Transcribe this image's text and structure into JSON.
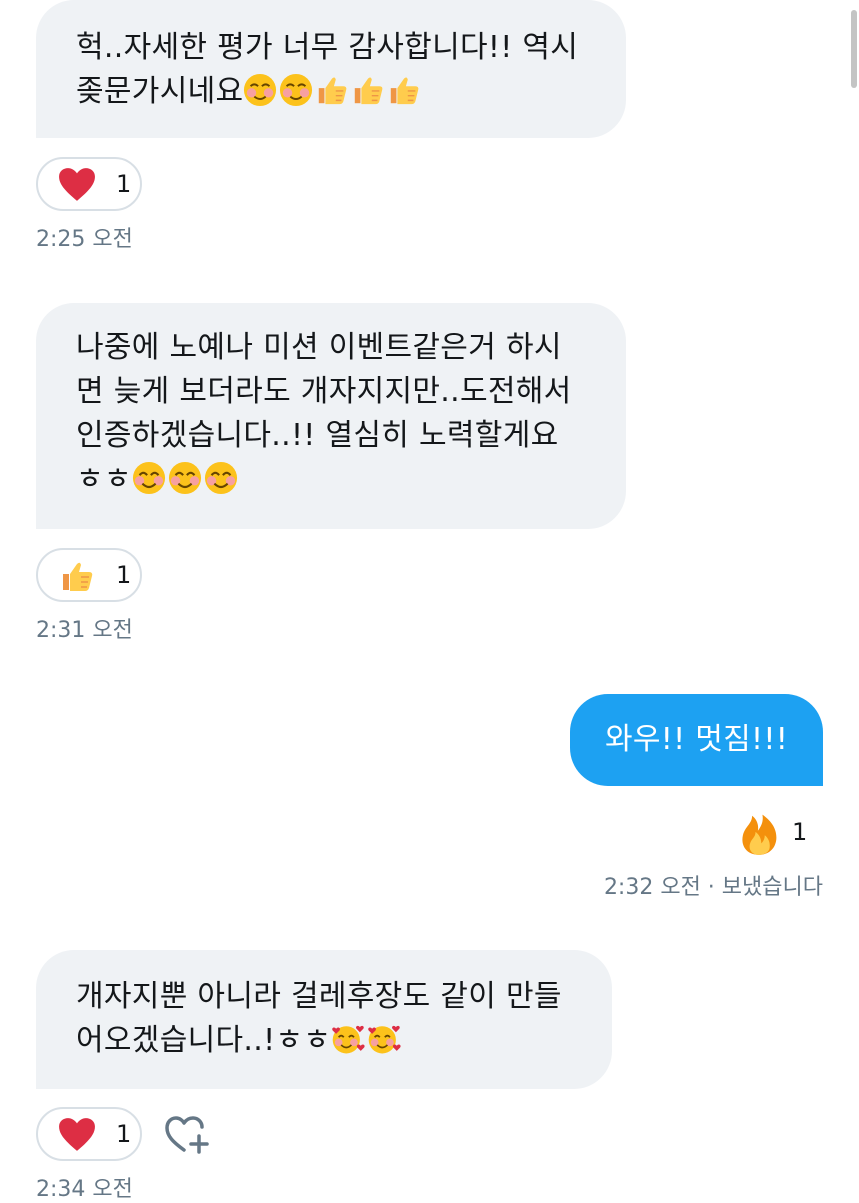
{
  "conversation": {
    "messages": [
      {
        "id": "m1",
        "direction": "incoming",
        "lines": [
          "헉..자세한 평가 너무 감사합니다!! 역시",
          "좆문가시네요"
        ],
        "emoji": [
          "smiling-face-icon",
          "smiling-face-icon",
          "thumbs-up-icon",
          "thumbs-up-icon",
          "thumbs-up-icon"
        ],
        "reaction": {
          "icon": "heart-icon",
          "count": "1"
        },
        "time": "2:25 오전"
      },
      {
        "id": "m2",
        "direction": "incoming",
        "lines": [
          "나중에 노예나 미션 이벤트같은거 하시",
          "면 늦게 보더라도 개자지지만..도전해서",
          "인증하겠습니다..!! 열심히 노력할게요",
          "ㅎㅎ"
        ],
        "emoji": [
          "smiling-eyes-icon",
          "smiling-eyes-icon",
          "smiling-eyes-icon"
        ],
        "reaction": {
          "icon": "thumbs-up-icon",
          "count": "1"
        },
        "time": "2:31 오전"
      },
      {
        "id": "m3",
        "direction": "outgoing",
        "lines": [
          "와우!! 멋짐!!!"
        ],
        "reaction": {
          "icon": "fire-icon",
          "count": "1"
        },
        "time": "2:32 오전 · 보냈습니다"
      },
      {
        "id": "m4",
        "direction": "incoming",
        "lines": [
          "개자지뿐 아니라 걸레후장도 같이 만들",
          "어오겠습니다..!ㅎㅎ"
        ],
        "emoji": [
          "smiling-hearts-icon",
          "smiling-hearts-icon"
        ],
        "reaction": {
          "icon": "heart-icon",
          "count": "1"
        },
        "time": "2:34 오전"
      }
    ]
  },
  "colors": {
    "incoming_bubble": "#eff2f5",
    "outgoing_bubble": "#1da1f2",
    "reaction_border": "#d8dfe5",
    "meta_text": "#657786",
    "heart": "#e0245e"
  }
}
